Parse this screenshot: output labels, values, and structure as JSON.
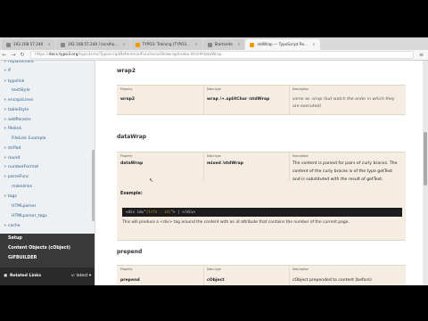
{
  "browser": {
    "tabs": [
      {
        "label": "192.168.57.240",
        "active": false,
        "favicon": "page-icon"
      },
      {
        "label": "192.168.57.240 / localho...",
        "active": false,
        "favicon": "page-icon"
      },
      {
        "label": "TYPO3: Training (TYPO3...",
        "active": false,
        "favicon": "typo3-icon"
      },
      {
        "label": "Startseite",
        "active": false,
        "favicon": "page-icon"
      },
      {
        "label": "stdWrap — TypoScript Re...",
        "active": true,
        "favicon": "typo3-icon"
      }
    ],
    "url_scheme": "https://",
    "url_host": "docs.typo3.org",
    "url_path": "/typo3cms/TyposcriptReference/Functions/Stdwrap/Index.html#dataWrap"
  },
  "sidebar": {
    "items": [
      {
        "label": "replacement",
        "toggle": "+",
        "indent": 0
      },
      {
        "label": "if",
        "toggle": "+",
        "indent": 0
      },
      {
        "label": "typolink",
        "toggle": "+",
        "indent": 0
      },
      {
        "label": "textStyle",
        "toggle": "",
        "indent": 1
      },
      {
        "label": "encapsLines",
        "toggle": "+",
        "indent": 0
      },
      {
        "label": "tableStyle",
        "toggle": "+",
        "indent": 0
      },
      {
        "label": "addParams",
        "toggle": "+",
        "indent": 0
      },
      {
        "label": "filelink",
        "toggle": "+",
        "indent": 0
      },
      {
        "label": "FileLink Example",
        "toggle": "",
        "indent": 1
      },
      {
        "label": "strPad",
        "toggle": "+",
        "indent": 0
      },
      {
        "label": "round",
        "toggle": "+",
        "indent": 0
      },
      {
        "label": "numberFormat",
        "toggle": "+",
        "indent": 0
      },
      {
        "label": "parseFunc",
        "toggle": "+",
        "indent": 0
      },
      {
        "label": "makelinks",
        "toggle": "",
        "indent": 1
      },
      {
        "label": "tags",
        "toggle": "+",
        "indent": 0
      },
      {
        "label": "HTMLparser",
        "toggle": "",
        "indent": 1
      },
      {
        "label": "HTMLparser_tags",
        "toggle": "",
        "indent": 1
      },
      {
        "label": "cache",
        "toggle": "+",
        "indent": 0
      }
    ],
    "dark_items": [
      "Setup",
      "Content Objects (cObject)",
      "GIFBUILDER"
    ],
    "footer_label": "Related Links",
    "footer_version": "v: latest ▾"
  },
  "content": {
    "sections": [
      {
        "title": "wrap2",
        "headers": [
          "Property",
          "Data type",
          "Description"
        ],
        "property": "wrap2",
        "datatype": "wrap /+.splitChar /stdWrap",
        "description": [
          "same as .wrap (but watch the order in which they",
          "are executed)"
        ]
      },
      {
        "title": "dataWrap",
        "headers": [
          "Property",
          "Data type",
          "Description"
        ],
        "property": "dataWrap",
        "datatype": "mixed /stdWrap",
        "description": [
          "The content is parsed for pairs of curly braces. The",
          "content of the curly braces is of the type getText",
          "and is substituted with the result of getText."
        ],
        "example_label": "Example:",
        "code": [
          "<div id=\"",
          "{tsfe : id}",
          "\"> | </div>"
        ],
        "note": "This will produce a <div> tag around the content with an id attribute that contains the number of the current page."
      },
      {
        "title": "prepend",
        "headers": [
          "Property",
          "Data type",
          "Description"
        ],
        "property": "prepend",
        "datatype": "cObject",
        "description": [
          "cObject prepended to content (before)"
        ]
      }
    ]
  }
}
